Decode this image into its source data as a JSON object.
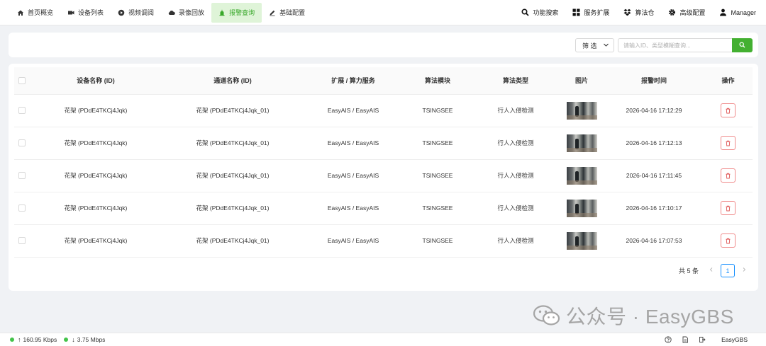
{
  "nav": {
    "left": [
      {
        "label": "首页概览",
        "icon": "home-icon",
        "active": false
      },
      {
        "label": "设备列表",
        "icon": "video-camera-icon",
        "active": false
      },
      {
        "label": "视频调阅",
        "icon": "play-circle-icon",
        "active": false
      },
      {
        "label": "录像回放",
        "icon": "cloud-icon",
        "active": false
      },
      {
        "label": "报警查询",
        "icon": "alarm-icon",
        "active": true
      },
      {
        "label": "基础配置",
        "icon": "edit-icon",
        "active": false
      }
    ],
    "right": [
      {
        "label": "功能搜索",
        "icon": "search-icon"
      },
      {
        "label": "服务扩展",
        "icon": "apps-grid-icon"
      },
      {
        "label": "算法仓",
        "icon": "dropbox-icon"
      },
      {
        "label": "高级配置",
        "icon": "gear-icon"
      },
      {
        "label": "Manager",
        "icon": "user-icon"
      }
    ]
  },
  "filter": {
    "select_label": "筛 选",
    "search_placeholder": "请输入ID、类型模糊查询..."
  },
  "table": {
    "columns": [
      "设备名称 (ID)",
      "通道名称 (ID)",
      "扩展 / 算力服务",
      "算法模块",
      "算法类型",
      "图片",
      "报警时间",
      "操作"
    ],
    "rows": [
      {
        "device": "花架 (PDdE4TKCj4Jqk)",
        "channel": "花架 (PDdE4TKCj4Jqk_01)",
        "service": "EasyAIS / EasyAIS",
        "module": "TSINGSEE",
        "type": "行人入侵检测",
        "time": "2026-04-16 17:12:29"
      },
      {
        "device": "花架 (PDdE4TKCj4Jqk)",
        "channel": "花架 (PDdE4TKCj4Jqk_01)",
        "service": "EasyAIS / EasyAIS",
        "module": "TSINGSEE",
        "type": "行人入侵检测",
        "time": "2026-04-16 17:12:13"
      },
      {
        "device": "花架 (PDdE4TKCj4Jqk)",
        "channel": "花架 (PDdE4TKCj4Jqk_01)",
        "service": "EasyAIS / EasyAIS",
        "module": "TSINGSEE",
        "type": "行人入侵检测",
        "time": "2026-04-16 17:11:45"
      },
      {
        "device": "花架 (PDdE4TKCj4Jqk)",
        "channel": "花架 (PDdE4TKCj4Jqk_01)",
        "service": "EasyAIS / EasyAIS",
        "module": "TSINGSEE",
        "type": "行人入侵检测",
        "time": "2026-04-16 17:10:17"
      },
      {
        "device": "花架 (PDdE4TKCj4Jqk)",
        "channel": "花架 (PDdE4TKCj4Jqk_01)",
        "service": "EasyAIS / EasyAIS",
        "module": "TSINGSEE",
        "type": "行人入侵检测",
        "time": "2026-04-16 17:07:53"
      }
    ]
  },
  "pager": {
    "total": "共 5 条",
    "current_page": "1"
  },
  "watermark": {
    "text": "公众号 · EasyGBS"
  },
  "status": {
    "upload": "160.95 Kbps",
    "download": "3.75 Mbps",
    "brand": "EasyGBS"
  },
  "colors": {
    "accent": "#43b031",
    "active_nav_bg": "#dff4d8",
    "delete_border": "#f08a8a",
    "pager_blue": "#1890ff",
    "status_dot": "#43c34a"
  }
}
